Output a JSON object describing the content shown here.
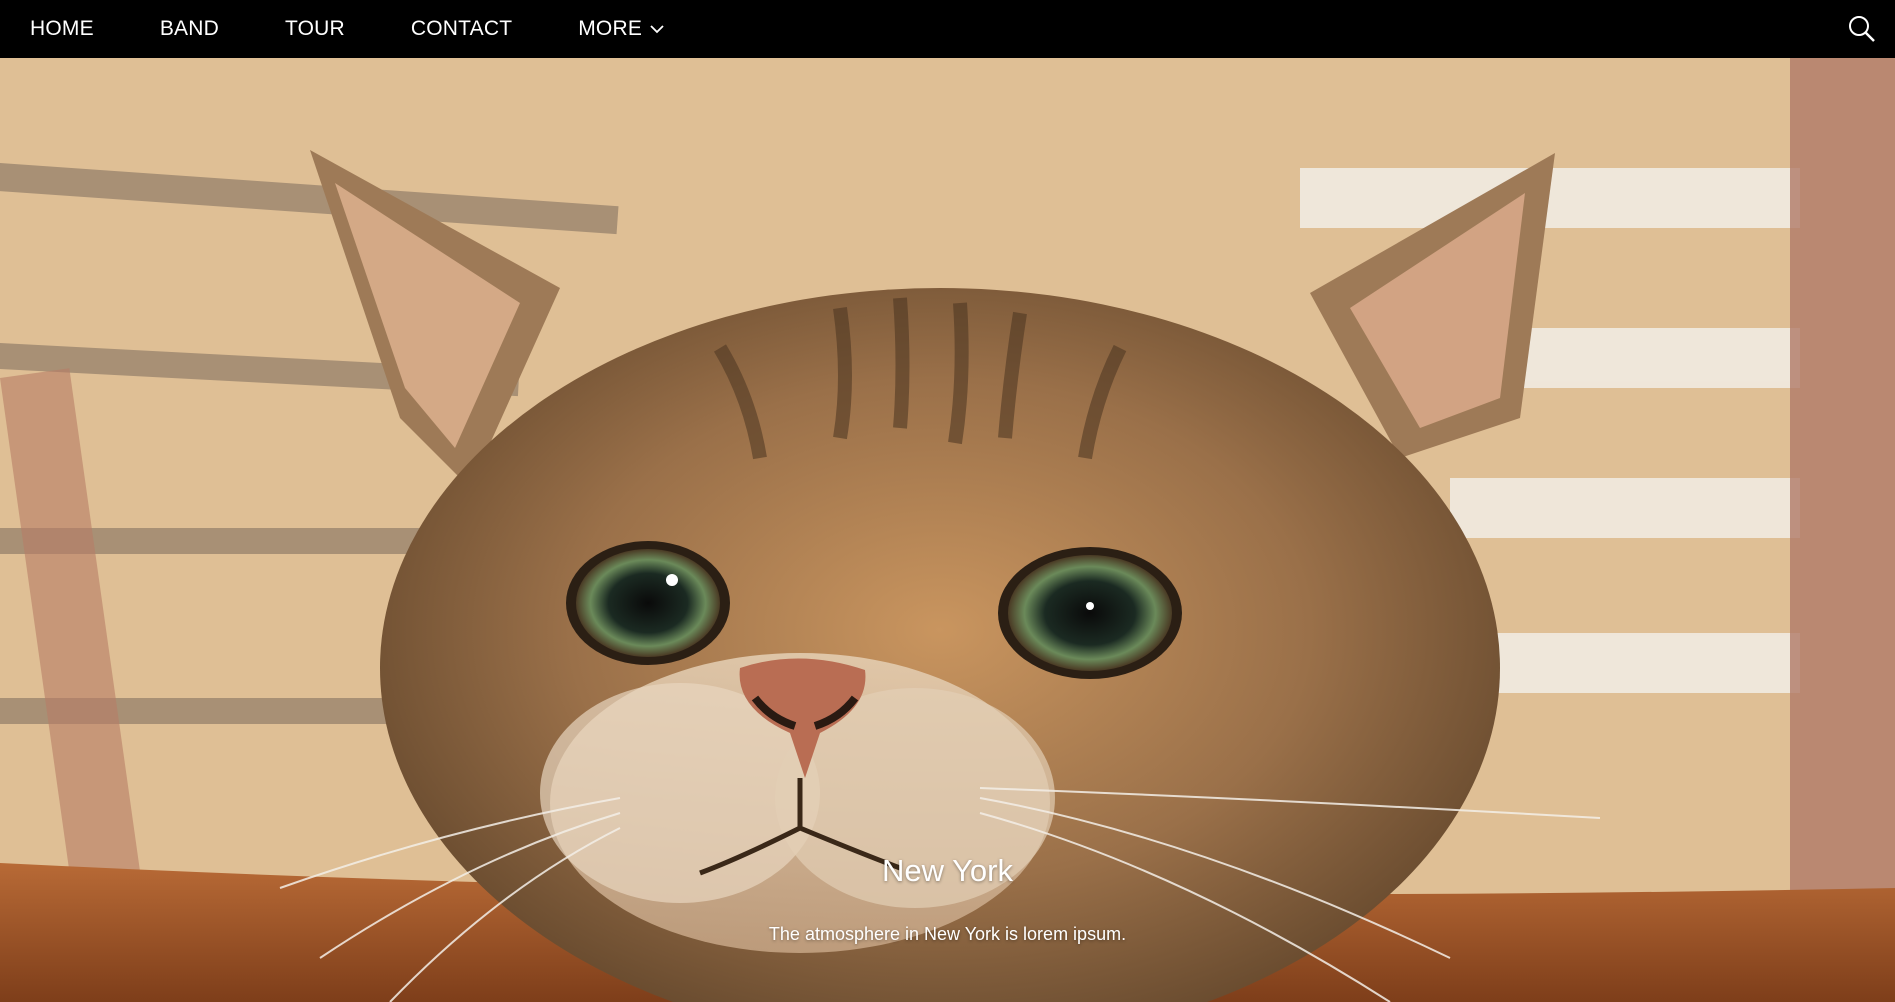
{
  "nav": {
    "items": [
      {
        "label": "HOME"
      },
      {
        "label": "BAND"
      },
      {
        "label": "TOUR"
      },
      {
        "label": "CONTACT"
      },
      {
        "label": "MORE"
      }
    ],
    "more_icon": "chevron-down-icon",
    "search_icon": "search-icon"
  },
  "hero": {
    "image_subject": "cat-photo",
    "title": "New York",
    "text": "The atmosphere in New York is lorem ipsum."
  },
  "colors": {
    "navbar_bg": "#000000",
    "nav_text": "#ffffff",
    "caption_text": "#ffffff"
  }
}
